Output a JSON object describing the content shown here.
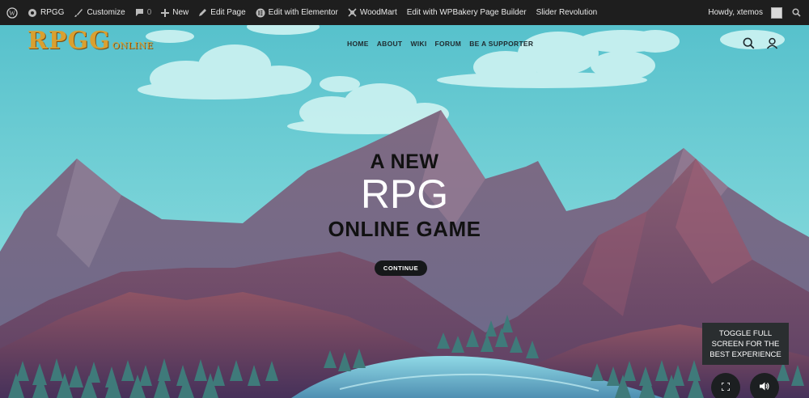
{
  "admin_bar": {
    "site_name": "RPGG",
    "customize": "Customize",
    "comments_count": "0",
    "new": "New",
    "edit_page": "Edit Page",
    "edit_elementor": "Edit with Elementor",
    "woodmart": "WoodMart",
    "edit_wpbakery": "Edit with WPBakery Page Builder",
    "slider_revolution": "Slider Revolution",
    "howdy": "Howdy, xtemos"
  },
  "logo": {
    "big": "RPGG",
    "small": "ONLINE"
  },
  "nav": [
    "HOME",
    "ABOUT",
    "WIKI",
    "FORUM",
    "BE A SUPPORTER"
  ],
  "hero": {
    "line1": "A NEW",
    "line2": "RPG",
    "line3": "ONLINE GAME",
    "button": "CONTINUE"
  },
  "fullscreen_note": "TOGGLE FULL SCREEN FOR THE BEST EXPERIENCE",
  "icons": [
    "wordpress-icon",
    "home-icon",
    "brush-icon",
    "comment-icon",
    "plus-icon",
    "pencil-icon",
    "elementor-icon",
    "woodmart-icon",
    "search-icon",
    "user-icon",
    "fullscreen-icon",
    "volume-icon"
  ],
  "colors": {
    "admin_bar": "#1e1e1e",
    "sky": "#5fc7d0",
    "logo": "#d9a030",
    "button": "#16181a"
  }
}
